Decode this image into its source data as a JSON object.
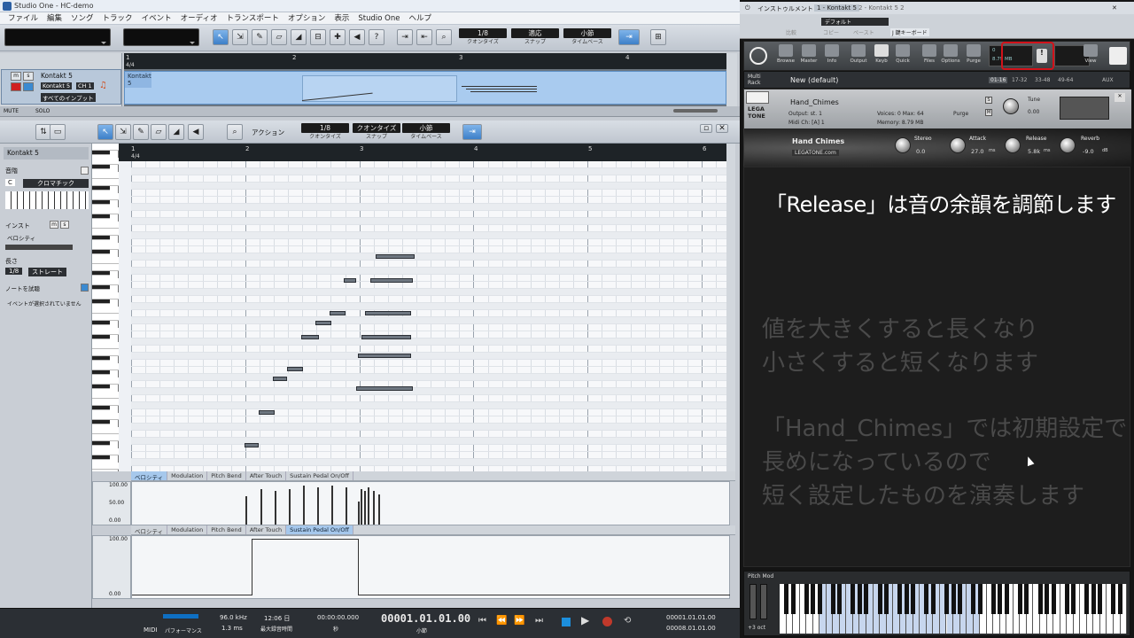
{
  "window": {
    "title": "Studio One - HC-demo"
  },
  "menu": [
    "ファイル",
    "編集",
    "ソング",
    "トラック",
    "イベント",
    "オーディオ",
    "トランスポート",
    "オプション",
    "表示",
    "Studio One",
    "ヘルプ"
  ],
  "toolbar": {
    "quantize": {
      "value": "1/8",
      "label": "クオンタイズ"
    },
    "snap": {
      "value": "適応",
      "label": "スナップ"
    },
    "timebase": {
      "value": "小節",
      "label": "タイムベース"
    }
  },
  "track": {
    "name": "Kontakt 5",
    "instrument": "Kontakt 5",
    "channel": "CH 1",
    "input": "すべてのインプット",
    "mute_label": "MUTE",
    "solo_label": "SOLO",
    "clip_name": "Kontakt 5"
  },
  "ruler_top": {
    "marks": [
      "1",
      "2",
      "3",
      "4"
    ],
    "signature": "4/4"
  },
  "editor": {
    "action_label": "アクション",
    "quantize": {
      "value": "1/8",
      "label": "クオンタイズ"
    },
    "snap": {
      "value": "クオンタイズ",
      "label": "スナップ"
    },
    "timebase": {
      "value": "小節",
      "label": "タイムベース"
    },
    "ruler": {
      "marks": [
        "1",
        "2",
        "3",
        "4",
        "5",
        "6"
      ],
      "signature": "4/4"
    }
  },
  "inspector": {
    "track_name": "Kontakt 5",
    "scale_label": "音階",
    "key": "C",
    "scale": "クロマチック",
    "inst_label": "インスト",
    "velocity_label": "ベロシティ",
    "length_label": "長さ",
    "length_value": "1/8",
    "length_mode": "ストレート",
    "note_preview": "ノートを試聴",
    "no_event": "イベントが選択されていません"
  },
  "lanes": {
    "tabs": [
      "ベロシティ",
      "Modulation",
      "Pitch Bend",
      "After Touch",
      "Sustain Pedal On/Off"
    ],
    "upper_scale": [
      "100.00",
      "50.00",
      "0.00"
    ],
    "lower_scale": [
      "100.00",
      "0.00"
    ],
    "upper_active": 0,
    "lower_active": 4
  },
  "transport": {
    "midi_label": "MIDI",
    "performance_label": "パフォーマンス",
    "sample_rate": "96.0 kHz",
    "latency": "1.3 ms",
    "max_time": "12:06 日",
    "max_time_label": "最大録音時間",
    "time": "00:00:00.000",
    "time_label": "秒",
    "position": "00001.01.01.00",
    "position_label": "小節",
    "loop_start": "00001.01.01.00",
    "loop_end": "00008.01.01.00"
  },
  "kontakt": {
    "tab_label": "インストゥルメント",
    "tab1": "1 - Kontakt 5",
    "tab2": "2 - Kontakt 5 2",
    "preset": "デフォルト",
    "sub_buttons": [
      "比較",
      "コピー",
      "ペースト"
    ],
    "keyboard_btn": "J 鍵キーボード",
    "main_icons": [
      "Browse",
      "Master",
      "Info",
      "Output",
      "Keyb",
      "Quick",
      "Files",
      "Options",
      "Purge",
      "View"
    ],
    "voices_cpu": "0",
    "memory_main": "8.79 MB",
    "rack_label": "Multi Rack",
    "rack_name": "New (default)",
    "rack_pages": [
      "01-16",
      "17-32",
      "33-48",
      "49-64"
    ],
    "rack_aux": "AUX",
    "instrument": {
      "name": "Hand_Chimes",
      "output": "st. 1",
      "voices": "0",
      "max": "64",
      "purge": "Purge",
      "midi_ch": "[A] 1",
      "memory": "8.79 MB",
      "tune_label": "Tune",
      "tune_value": "0.00",
      "logo": "LEGA TONE",
      "title": "Hand Chimes",
      "site": "LEGATONE.com",
      "stereo_label": "Stereo",
      "stereo_value": "0.0",
      "attack_label": "Attack",
      "attack_value": "27.0",
      "attack_unit": "ms",
      "release_label": "Release",
      "release_value": "5.8k",
      "release_unit": "ms",
      "reverb_label": "Reverb",
      "reverb_value": "-9.0",
      "reverb_unit": "dB"
    },
    "caption_main": "「Release」は音の余韻を調節します",
    "caption_lines": [
      "値を大きくすると長くなり",
      "小さくすると短くなります",
      "「Hand_Chimes」では初期設定で",
      "長めになっているので",
      "短く設定したものを演奏します"
    ],
    "pitch_mod_label": "Pitch Mod",
    "octave_label": "+3 oct"
  }
}
